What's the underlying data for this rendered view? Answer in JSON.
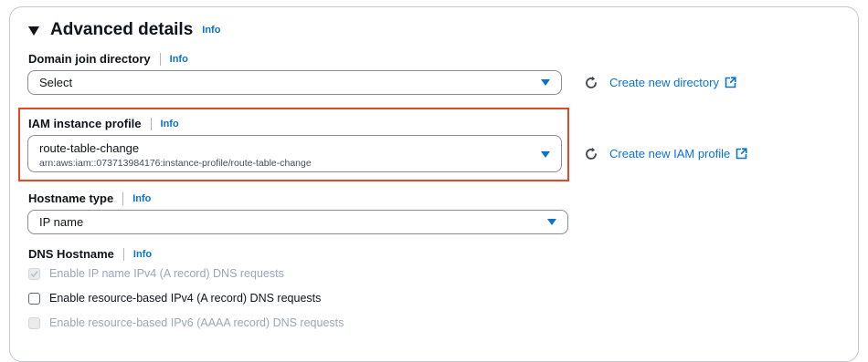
{
  "section": {
    "title": "Advanced details",
    "info": "Info"
  },
  "domain_join": {
    "label": "Domain join directory",
    "info": "Info",
    "value": "Select",
    "create_link": "Create new directory"
  },
  "iam_profile": {
    "label": "IAM instance profile",
    "info": "Info",
    "value": "route-table-change",
    "arn": "arn:aws:iam::073713984176:instance-profile/route-table-change",
    "create_link": "Create new IAM profile"
  },
  "hostname_type": {
    "label": "Hostname type",
    "info": "Info",
    "value": "IP name"
  },
  "dns_hostname": {
    "label": "DNS Hostname",
    "info": "Info",
    "options": [
      {
        "label": "Enable IP name IPv4 (A record) DNS requests",
        "checked": true,
        "disabled": true
      },
      {
        "label": "Enable resource-based IPv4 (A record) DNS requests",
        "checked": false,
        "disabled": false
      },
      {
        "label": "Enable resource-based IPv6 (AAAA record) DNS requests",
        "checked": false,
        "disabled": true
      }
    ]
  },
  "colors": {
    "link": "#0972d3",
    "highlight": "#e14a25",
    "text": "#0f141a"
  }
}
